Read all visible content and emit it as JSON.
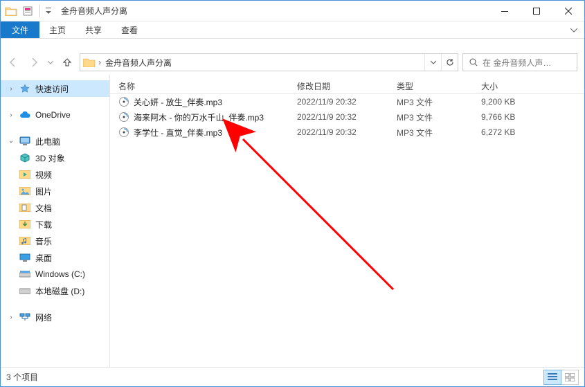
{
  "title": "金舟音频人声分离",
  "ribbon": {
    "file": "文件",
    "tabs": [
      "主页",
      "共享",
      "查看"
    ]
  },
  "breadcrumb": {
    "folder": "金舟音频人声分离"
  },
  "search": {
    "placeholder": "在 金舟音频人声…"
  },
  "navtree": {
    "quick_access": "快速访问",
    "onedrive": "OneDrive",
    "this_pc": "此电脑",
    "items": [
      "3D 对象",
      "视频",
      "图片",
      "文档",
      "下载",
      "音乐",
      "桌面",
      "Windows (C:)",
      "本地磁盘 (D:)"
    ],
    "network": "网络"
  },
  "columns": {
    "name": "名称",
    "date": "修改日期",
    "type": "类型",
    "size": "大小"
  },
  "files": [
    {
      "name": "关心妍 - 放生_伴奏.mp3",
      "date": "2022/11/9 20:32",
      "type": "MP3 文件",
      "size": "9,200 KB"
    },
    {
      "name": "海来阿木 - 你的万水千山_伴奏.mp3",
      "date": "2022/11/9 20:32",
      "type": "MP3 文件",
      "size": "9,766 KB"
    },
    {
      "name": "李学仕 - 直觉_伴奏.mp3",
      "date": "2022/11/9 20:32",
      "type": "MP3 文件",
      "size": "6,272 KB"
    }
  ],
  "status": {
    "count": "3 个项目"
  }
}
